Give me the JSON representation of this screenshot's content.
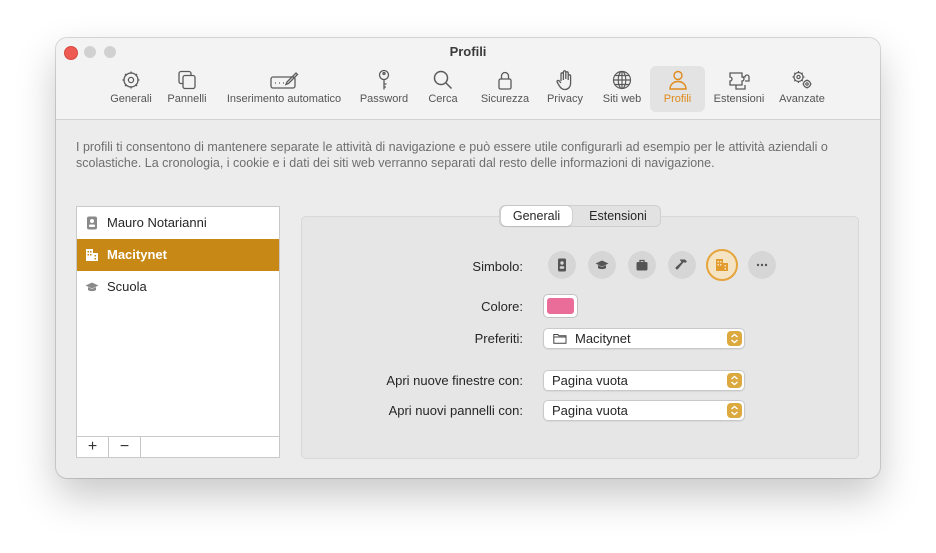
{
  "window": {
    "title": "Profili"
  },
  "toolbar": {
    "items": [
      {
        "label": "Generali",
        "icon": "gear-icon"
      },
      {
        "label": "Pannelli",
        "icon": "tabs-icon"
      },
      {
        "label": "Inserimento automatico",
        "icon": "autofill-icon"
      },
      {
        "label": "Password",
        "icon": "key-icon"
      },
      {
        "label": "Cerca",
        "icon": "search-icon"
      },
      {
        "label": "Sicurezza",
        "icon": "lock-icon"
      },
      {
        "label": "Privacy",
        "icon": "hand-icon"
      },
      {
        "label": "Siti web",
        "icon": "globe-icon"
      },
      {
        "label": "Profili",
        "icon": "person-icon",
        "active": true
      },
      {
        "label": "Estensioni",
        "icon": "puzzle-icon"
      },
      {
        "label": "Avanzate",
        "icon": "gears-icon"
      }
    ]
  },
  "description": "I profili ti consentono di mantenere separate le attività di navigazione e può essere utile configurarli ad esempio per le attività aziendali o scolastiche. La cronologia, i cookie e i dati dei siti web verranno separati dal resto delle informazioni di navigazione.",
  "profiles": {
    "items": [
      {
        "label": "Mauro Notarianni",
        "icon": "id-badge-icon"
      },
      {
        "label": "Macitynet",
        "icon": "building-icon",
        "selected": true
      },
      {
        "label": "Scuola",
        "icon": "graduation-cap-icon"
      }
    ],
    "add_label": "+",
    "remove_label": "−"
  },
  "tabs": {
    "general": "Generali",
    "extensions": "Estensioni"
  },
  "form": {
    "symbol_label": "Simbolo:",
    "symbols": [
      "id-badge-icon",
      "graduation-cap-icon",
      "briefcase-icon",
      "hammer-icon",
      "building-icon",
      "ellipsis-icon"
    ],
    "selected_symbol": "building-icon",
    "color_label": "Colore:",
    "color_value": "#ea6c98",
    "favorites_label": "Preferiti:",
    "favorites_value": "Macitynet",
    "new_windows_label": "Apri nuove finestre con:",
    "new_windows_value": "Pagina vuota",
    "new_tabs_label": "Apri nuovi pannelli con:",
    "new_tabs_value": "Pagina vuota"
  },
  "colors": {
    "accent": "#e08a1b",
    "selection": "#c88816",
    "stepper": "#dca93f"
  }
}
